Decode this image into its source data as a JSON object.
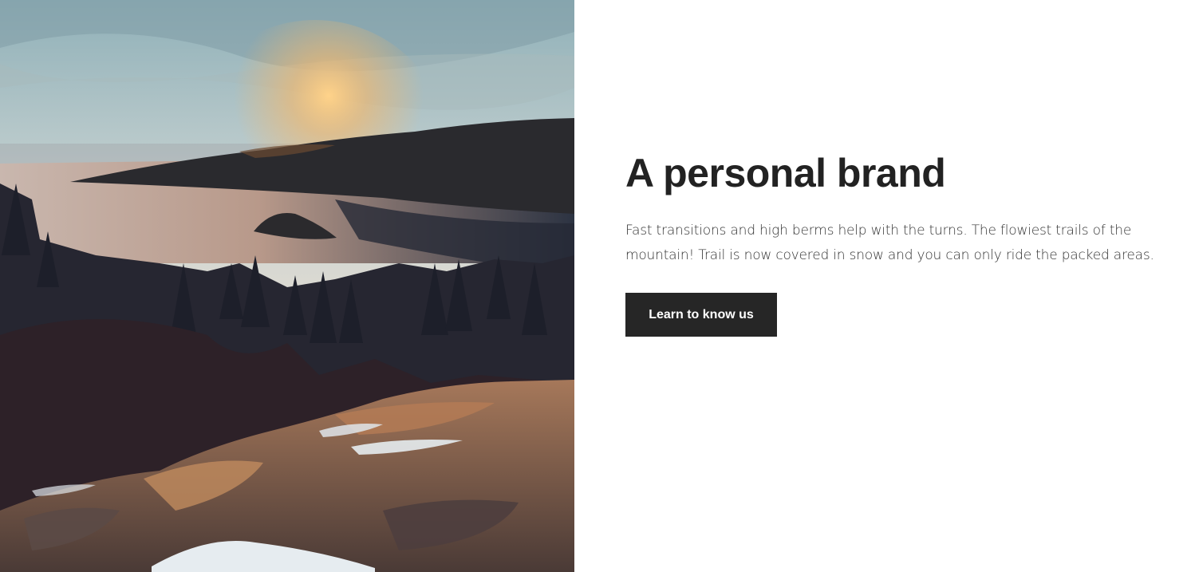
{
  "hero": {
    "image_name": "mountain-lake-sunset-photo"
  },
  "content": {
    "title": "A personal brand",
    "description_line1": "Fast transitions and high berms help with the turns. The flowiest trails of the",
    "description_line2": "mountain! Trail is now covered in snow and you can only ride the packed areas.",
    "button_label": "Learn to know us"
  },
  "colors": {
    "title": "#222222",
    "text": "#333333",
    "button_bg": "#262626",
    "button_text": "#ffffff"
  }
}
